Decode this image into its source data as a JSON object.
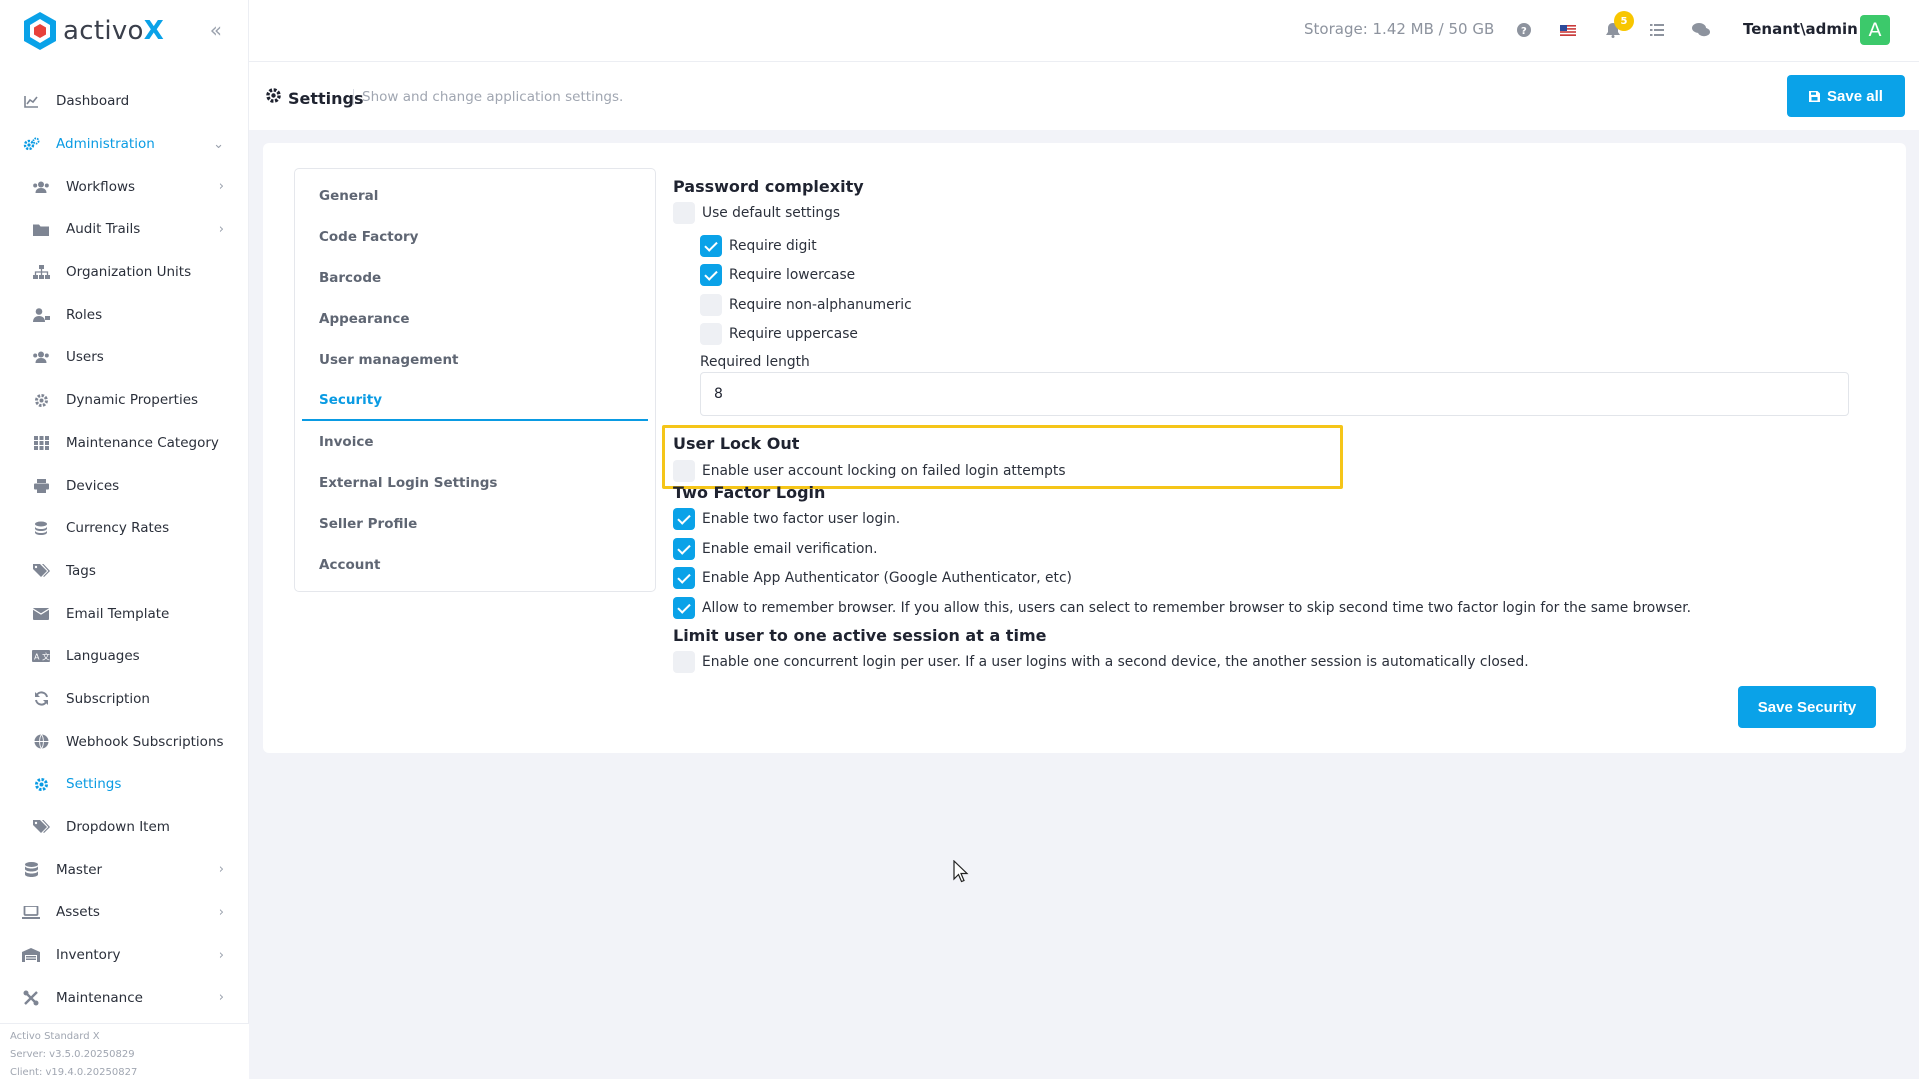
{
  "brand": {
    "name_prefix": "activo",
    "name_suffix": "X"
  },
  "header": {
    "storage": "Storage: 1.42 MB / 50 GB",
    "notification_count": "5",
    "user": "Tenant\\admin",
    "avatar_letter": "A"
  },
  "sidebar": {
    "items": [
      {
        "label": "Dashboard",
        "icon": "chart-icon"
      },
      {
        "label": "Administration",
        "icon": "cogs-icon"
      },
      {
        "label": "Workflows",
        "icon": "users-icon"
      },
      {
        "label": "Audit Trails",
        "icon": "folder-icon"
      },
      {
        "label": "Organization Units",
        "icon": "sitemap-icon"
      },
      {
        "label": "Roles",
        "icon": "user-tag-icon"
      },
      {
        "label": "Users",
        "icon": "users-icon"
      },
      {
        "label": "Dynamic Properties",
        "icon": "gear-icon"
      },
      {
        "label": "Maintenance Category",
        "icon": "grid-icon"
      },
      {
        "label": "Devices",
        "icon": "printer-icon"
      },
      {
        "label": "Currency Rates",
        "icon": "coins-icon"
      },
      {
        "label": "Tags",
        "icon": "tags-icon"
      },
      {
        "label": "Email Template",
        "icon": "envelope-icon"
      },
      {
        "label": "Languages",
        "icon": "language-icon"
      },
      {
        "label": "Subscription",
        "icon": "refresh-icon"
      },
      {
        "label": "Webhook Subscriptions",
        "icon": "globe-icon"
      },
      {
        "label": "Settings",
        "icon": "gear-icon"
      },
      {
        "label": "Dropdown Item",
        "icon": "tags-icon"
      },
      {
        "label": "Master",
        "icon": "database-icon"
      },
      {
        "label": "Assets",
        "icon": "laptop-icon"
      },
      {
        "label": "Inventory",
        "icon": "warehouse-icon"
      },
      {
        "label": "Maintenance",
        "icon": "tools-icon"
      }
    ],
    "version": {
      "product": "Activo Standard X",
      "server": "Server: v3.5.0.20250829",
      "client": "Client: v19.4.0.20250827"
    }
  },
  "subheader": {
    "title": "Settings",
    "description": "Show and change application settings.",
    "save_all": "Save all"
  },
  "tabs": [
    "General",
    "Code Factory",
    "Barcode",
    "Appearance",
    "User management",
    "Security",
    "Invoice",
    "External Login Settings",
    "Seller Profile",
    "Account"
  ],
  "security": {
    "password_complexity": {
      "title": "Password complexity",
      "use_default": "Use default settings",
      "require_digit": "Require digit",
      "require_lowercase": "Require lowercase",
      "require_nonalnum": "Require non-alphanumeric",
      "require_uppercase": "Require uppercase",
      "required_length_label": "Required length",
      "required_length_value": "8"
    },
    "lockout": {
      "title": "User Lock Out",
      "enable": "Enable user account locking on failed login attempts"
    },
    "two_factor": {
      "title": "Two Factor Login",
      "enable": "Enable two factor user login.",
      "email": "Enable email verification.",
      "authenticator": "Enable App Authenticator (Google Authenticator, etc)",
      "remember": "Allow to remember browser. If you allow this, users can select to remember browser to skip second time two factor login for the same browser."
    },
    "session": {
      "title": "Limit user to one active session at a time",
      "enable": "Enable one concurrent login per user. If a user logins with a second device, the another session is automatically closed."
    },
    "save": "Save Security"
  },
  "colors": {
    "accent": "#0aa2e8",
    "highlight": "#f5c518",
    "avatar": "#3cc96b"
  }
}
